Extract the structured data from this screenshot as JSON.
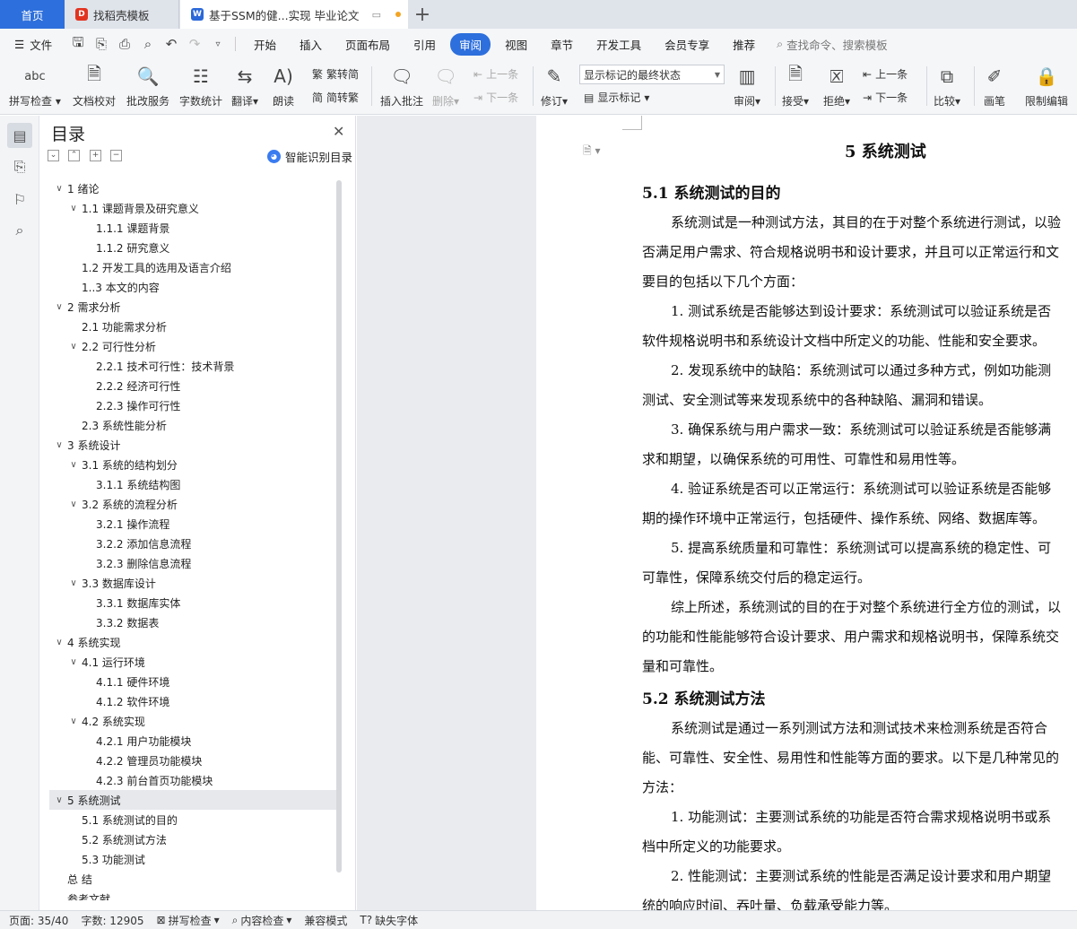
{
  "tabs": {
    "home": "首页",
    "template": "找稻壳模板",
    "document": "基于SSM的健...实现 毕业论文",
    "new_tab": "+"
  },
  "menu": {
    "file": "文件",
    "tabs": [
      "开始",
      "插入",
      "页面布局",
      "引用",
      "审阅",
      "视图",
      "章节",
      "开发工具",
      "会员专享",
      "推荐"
    ],
    "active_tab": "审阅",
    "search_placeholder": "查找命令、搜索模板"
  },
  "ribbon": {
    "spell_check": "拼写检查",
    "doc_proof": "文档校对",
    "batch_service": "批改服务",
    "word_count": "字数统计",
    "translate": "翻译",
    "read_aloud": "朗读",
    "trad_to_simp": "繁转简",
    "simp_to_trad": "简转繁",
    "insert_comment": "插入批注",
    "delete": "删除",
    "prev_item": "上一条",
    "next_item": "下一条",
    "revise": "修订",
    "mark_mode": "显示标记的最终状态",
    "show_marks": "显示标记",
    "review": "审阅",
    "accept": "接受",
    "reject": "拒绝",
    "prev_change": "上一条",
    "next_change": "下一条",
    "compare": "比较",
    "pen": "画笔",
    "restrict_edit": "限制编辑",
    "abc_glyph": "abc"
  },
  "toc": {
    "title": "目录",
    "smart_label": "智能识别目录",
    "items": [
      {
        "text": "1  绪论",
        "level": 0,
        "toggle": "∨"
      },
      {
        "text": "1.1  课题背景及研究意义",
        "level": 1,
        "toggle": "∨"
      },
      {
        "text": "1.1.1  课题背景",
        "level": 2,
        "toggle": ""
      },
      {
        "text": "1.1.2  研究意义",
        "level": 2,
        "toggle": ""
      },
      {
        "text": "1.2  开发工具的选用及语言介绍",
        "level": 1,
        "toggle": ""
      },
      {
        "text": "1..3 本文的内容",
        "level": 1,
        "toggle": ""
      },
      {
        "text": "2  需求分析",
        "level": 0,
        "toggle": "∨"
      },
      {
        "text": "2.1  功能需求分析",
        "level": 1,
        "toggle": ""
      },
      {
        "text": "2.2  可行性分析",
        "level": 1,
        "toggle": "∨"
      },
      {
        "text": "2.2.1 技术可行性：技术背景",
        "level": 2,
        "toggle": ""
      },
      {
        "text": "2.2.2 经济可行性",
        "level": 2,
        "toggle": ""
      },
      {
        "text": "2.2.3 操作可行性",
        "level": 2,
        "toggle": ""
      },
      {
        "text": "2.3 系统性能分析",
        "level": 1,
        "toggle": ""
      },
      {
        "text": "3  系统设计",
        "level": 0,
        "toggle": "∨"
      },
      {
        "text": "3.1  系统的结构划分",
        "level": 1,
        "toggle": "∨"
      },
      {
        "text": "3.1.1  系统结构图",
        "level": 2,
        "toggle": ""
      },
      {
        "text": "3.2  系统的流程分析",
        "level": 1,
        "toggle": "∨"
      },
      {
        "text": "3.2.1 操作流程",
        "level": 2,
        "toggle": ""
      },
      {
        "text": "3.2.2 添加信息流程",
        "level": 2,
        "toggle": ""
      },
      {
        "text": "3.2.3 删除信息流程",
        "level": 2,
        "toggle": ""
      },
      {
        "text": "3.3 数据库设计",
        "level": 1,
        "toggle": "∨"
      },
      {
        "text": "3.3.1  数据库实体",
        "level": 2,
        "toggle": ""
      },
      {
        "text": "3.3.2 数据表",
        "level": 2,
        "toggle": ""
      },
      {
        "text": "4  系统实现",
        "level": 0,
        "toggle": "∨"
      },
      {
        "text": "4.1  运行环境",
        "level": 1,
        "toggle": "∨"
      },
      {
        "text": "4.1.1  硬件环境",
        "level": 2,
        "toggle": ""
      },
      {
        "text": "4.1.2  软件环境",
        "level": 2,
        "toggle": ""
      },
      {
        "text": "4.2  系统实现",
        "level": 1,
        "toggle": "∨"
      },
      {
        "text": "4.2.1 用户功能模块",
        "level": 2,
        "toggle": ""
      },
      {
        "text": "4.2.2 管理员功能模块",
        "level": 2,
        "toggle": ""
      },
      {
        "text": "4.2.3 前台首页功能模块",
        "level": 2,
        "toggle": ""
      },
      {
        "text": "5  系统测试",
        "level": 0,
        "toggle": "∨",
        "active": true
      },
      {
        "text": "5.1 系统测试的目的",
        "level": 1,
        "toggle": ""
      },
      {
        "text": "5.2 系统测试方法",
        "level": 1,
        "toggle": ""
      },
      {
        "text": "5.3 功能测试",
        "level": 1,
        "toggle": ""
      },
      {
        "text": "总   结",
        "level": 0,
        "toggle": ""
      },
      {
        "text": "参考文献",
        "level": 0,
        "toggle": ""
      }
    ]
  },
  "document": {
    "chapter_title": "5  系统测试",
    "section_1": "5.1 系统测试的目的",
    "section_2": "5.2 系统测试方法",
    "lines": [
      {
        "text": "系统测试是一种测试方法，其目的在于对整个系统进行测试，以验",
        "indent": true
      },
      {
        "text": "否满足用户需求、符合规格说明书和设计要求，并且可以正常运行和文",
        "indent": false
      },
      {
        "text": "要目的包括以下几个方面：",
        "indent": false
      },
      {
        "text": "1. 测试系统是否能够达到设计要求：系统测试可以验证系统是否",
        "indent": true
      },
      {
        "text": "软件规格说明书和系统设计文档中所定义的功能、性能和安全要求。",
        "indent": false
      },
      {
        "text": "2. 发现系统中的缺陷：系统测试可以通过多种方式，例如功能测",
        "indent": true
      },
      {
        "text": "测试、安全测试等来发现系统中的各种缺陷、漏洞和错误。",
        "indent": false
      },
      {
        "text": "3. 确保系统与用户需求一致：系统测试可以验证系统是否能够满",
        "indent": true
      },
      {
        "text": "求和期望，以确保系统的可用性、可靠性和易用性等。",
        "indent": false
      },
      {
        "text": "4. 验证系统是否可以正常运行：系统测试可以验证系统是否能够",
        "indent": true
      },
      {
        "text": "期的操作环境中正常运行，包括硬件、操作系统、网络、数据库等。",
        "indent": false
      },
      {
        "text": "5. 提高系统质量和可靠性：系统测试可以提高系统的稳定性、可",
        "indent": true
      },
      {
        "text": "可靠性，保障系统交付后的稳定运行。",
        "indent": false
      },
      {
        "text": "综上所述，系统测试的目的在于对整个系统进行全方位的测试，以",
        "indent": true
      },
      {
        "text": "的功能和性能能够符合设计要求、用户需求和规格说明书，保障系统交",
        "indent": false
      },
      {
        "text": "量和可靠性。",
        "indent": false
      }
    ],
    "lines_2": [
      {
        "text": "系统测试是通过一系列测试方法和测试技术来检测系统是否符合",
        "indent": true
      },
      {
        "text": "能、可靠性、安全性、易用性和性能等方面的要求。以下是几种常见的",
        "indent": false
      },
      {
        "text": "方法：",
        "indent": false
      },
      {
        "text": "1. 功能测试：主要测试系统的功能是否符合需求规格说明书或系",
        "indent": true
      },
      {
        "text": "档中所定义的功能要求。",
        "indent": false
      },
      {
        "text": "2. 性能测试：主要测试系统的性能是否满足设计要求和用户期望",
        "indent": true
      },
      {
        "text": "统的响应时间、吞吐量、负载承受能力等。",
        "indent": false
      }
    ]
  },
  "status": {
    "page": "页面: 35/40",
    "word_count": "字数: 12905",
    "spell_check": "拼写检查",
    "content_check": "内容检查",
    "compat_mode": "兼容模式",
    "missing_font": "缺失字体"
  }
}
